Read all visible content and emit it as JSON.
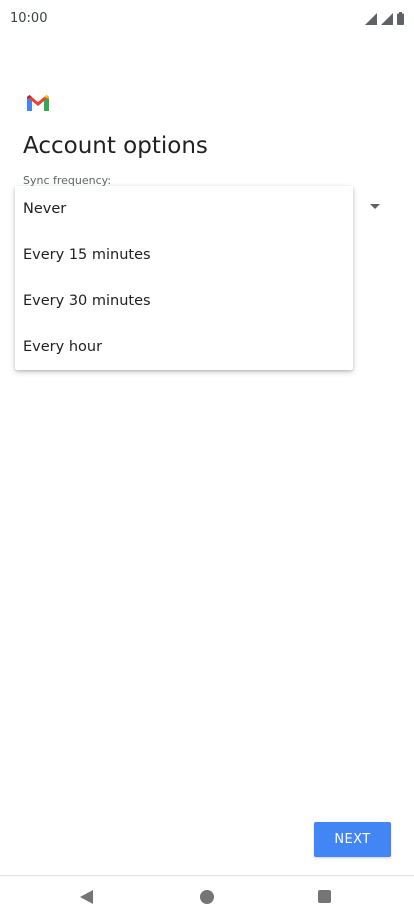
{
  "status_bar": {
    "time": "10:00",
    "icons": [
      "cellular-signal-icon",
      "cellular-signal-icon",
      "battery-icon"
    ]
  },
  "app": {
    "logo": "gmail-logo-icon",
    "title": "Account options"
  },
  "sync": {
    "label": "Sync frequency:",
    "options": [
      "Never",
      "Every 15 minutes",
      "Every 30 minutes",
      "Every hour"
    ]
  },
  "actions": {
    "next_label": "NEXT"
  },
  "colors": {
    "accent": "#4285f4",
    "text": "#202124",
    "secondary_text": "#5f6368",
    "nav_icon": "#757575"
  },
  "nav_bar": {
    "icons": [
      "back-icon",
      "home-icon",
      "recents-icon"
    ]
  }
}
